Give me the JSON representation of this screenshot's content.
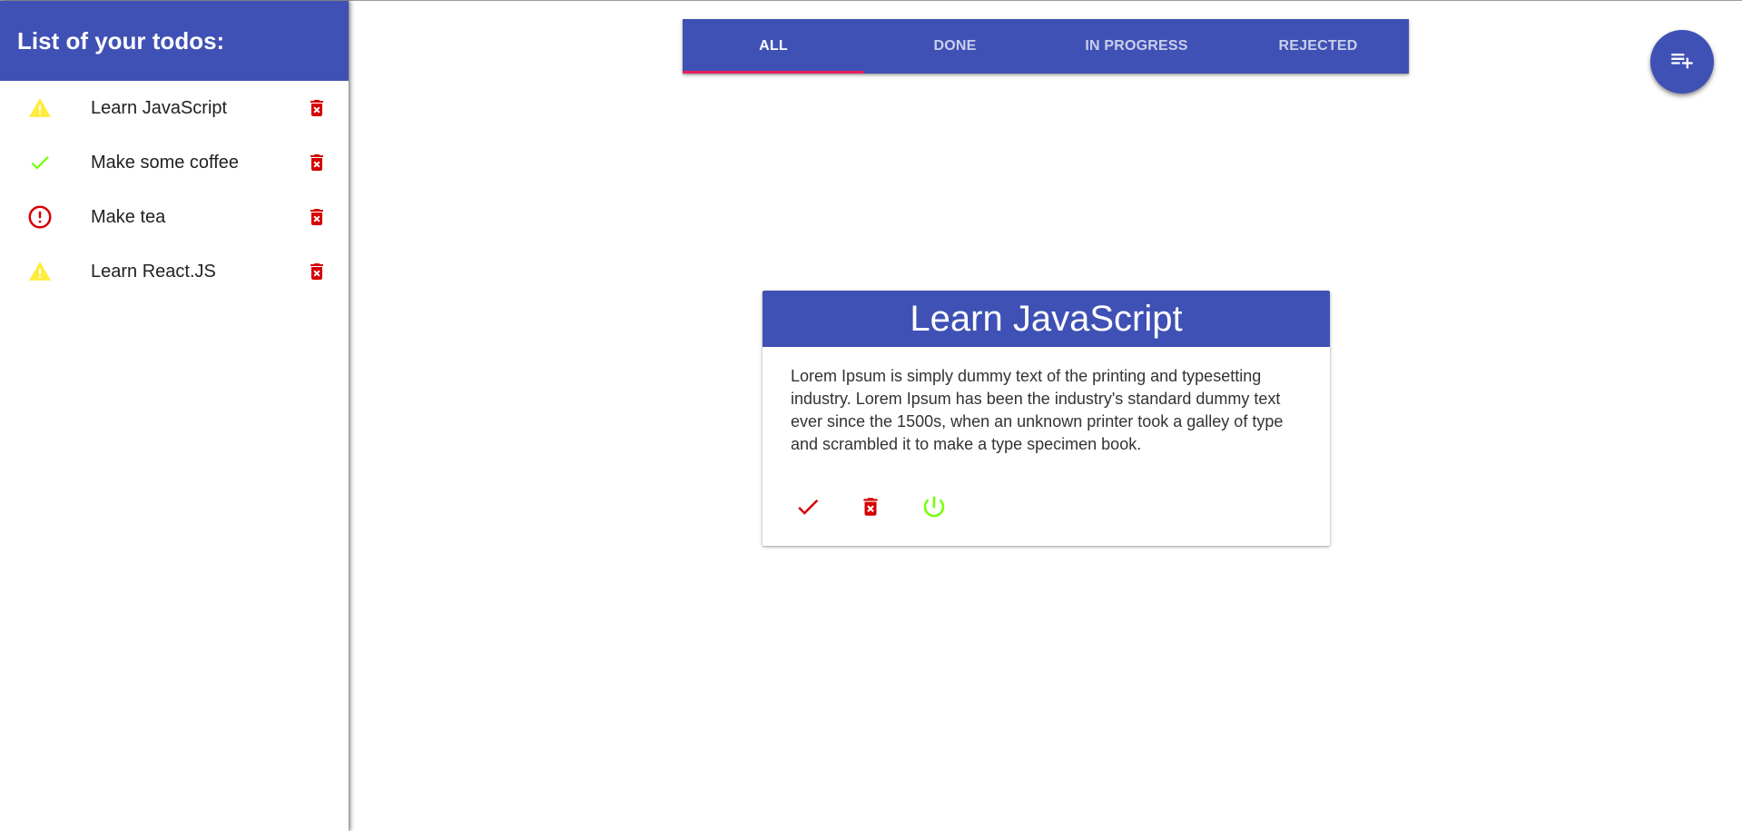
{
  "sidebar": {
    "title": "List of your todos:",
    "items": [
      {
        "label": "Learn JavaScript",
        "status_icon": "warning-icon",
        "status_color": "#ffeb3b"
      },
      {
        "label": "Make some coffee",
        "status_icon": "check-icon",
        "status_color": "#76ff03"
      },
      {
        "label": "Make tea",
        "status_icon": "error-outline-icon",
        "status_color": "#d50000"
      },
      {
        "label": "Learn React.JS",
        "status_icon": "warning-icon",
        "status_color": "#ffeb3b"
      }
    ],
    "delete_icon": "delete-forever-icon",
    "delete_color": "#d50000"
  },
  "tabs": {
    "items": [
      "ALL",
      "DONE",
      "IN PROGRESS",
      "REJECTED"
    ],
    "active": "ALL"
  },
  "fab": {
    "icon": "playlist-add-icon"
  },
  "card": {
    "title": "Learn JavaScript",
    "text": "Lorem Ipsum is simply dummy text of the printing and typesetting industry. Lorem Ipsum has been the industry's standard dummy text ever since the 1500s, when an unknown printer took a galley of type and scrambled it to make a type specimen book.",
    "actions": [
      {
        "icon": "check-icon",
        "color": "#d50000"
      },
      {
        "icon": "delete-forever-icon",
        "color": "#d50000"
      },
      {
        "icon": "power-icon",
        "color": "#76ff03"
      }
    ]
  },
  "colors": {
    "primary": "#3f51b5",
    "tab_indicator": "#e91e63",
    "warning": "#ffeb3b",
    "success": "#76ff03",
    "danger": "#d50000"
  }
}
